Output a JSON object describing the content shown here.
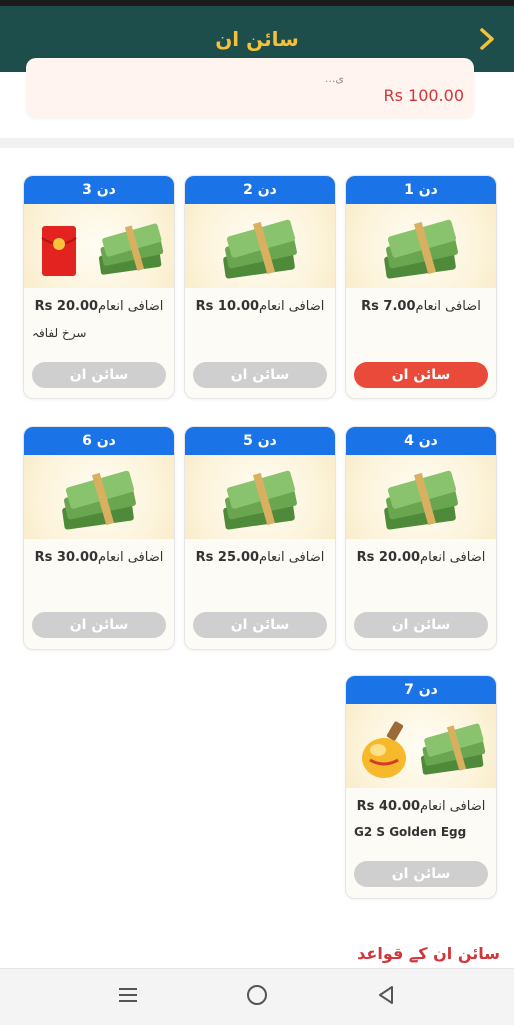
{
  "header": {
    "title": "سائن ان"
  },
  "top_card": {
    "amount": "Rs 100.00",
    "cut_text": "...ی"
  },
  "days": [
    {
      "label": "دن 1",
      "reward_urdu": "اضافی انعام",
      "reward_amount": "Rs 7.00",
      "extra": "",
      "button": "سائن ان",
      "active": true
    },
    {
      "label": "دن 2",
      "reward_urdu": "اضافی انعام",
      "reward_amount": "Rs 10.00",
      "extra": "",
      "button": "سائن ان",
      "active": false
    },
    {
      "label": "دن 3",
      "reward_urdu": "اضافی انعام",
      "reward_amount": "Rs 20.00",
      "extra": "سرخ لفافہ",
      "button": "سائن ان",
      "active": false
    },
    {
      "label": "دن 4",
      "reward_urdu": "اضافی انعام",
      "reward_amount": "Rs 20.00",
      "extra": "",
      "button": "سائن ان",
      "active": false
    },
    {
      "label": "دن 5",
      "reward_urdu": "اضافی انعام",
      "reward_amount": "Rs 25.00",
      "extra": "",
      "button": "سائن ان",
      "active": false
    },
    {
      "label": "دن 6",
      "reward_urdu": "اضافی انعام",
      "reward_amount": "Rs 30.00",
      "extra": "",
      "button": "سائن ان",
      "active": false
    },
    {
      "label": "دن 7",
      "reward_urdu": "اضافی انعام",
      "reward_amount": "Rs 40.00",
      "extra": "G2 S Golden Egg",
      "button": "سائن ان",
      "active": false
    }
  ],
  "rules_link": "سائن ان کے قواعد",
  "colors": {
    "header_bg": "#1e4e4c",
    "title": "#f3c23a",
    "day_header": "#1b73e8",
    "active_button": "#ea4a3a",
    "inactive_button": "#cfcfcf"
  },
  "icons": {
    "back": "chevron-right-icon",
    "nav_menu": "menu-icon",
    "nav_home": "home-circle-icon",
    "nav_back": "back-triangle-icon"
  }
}
